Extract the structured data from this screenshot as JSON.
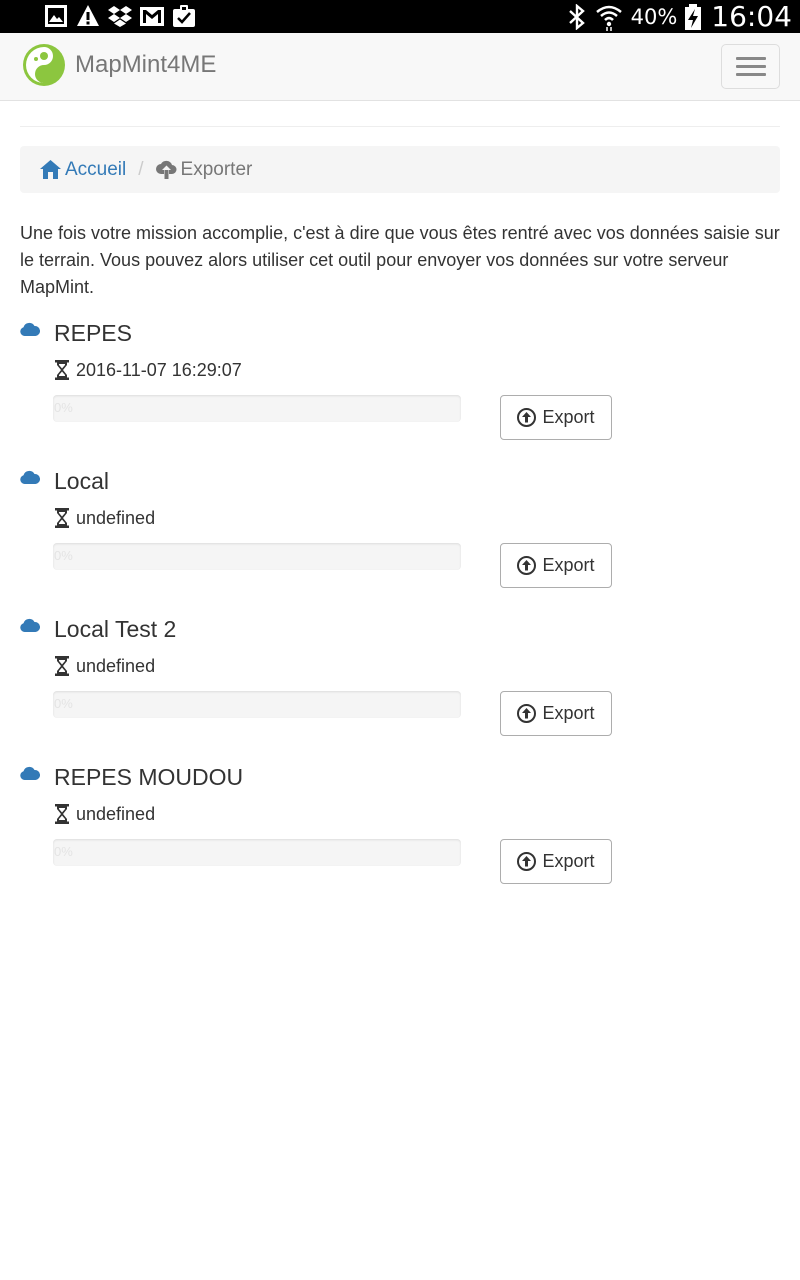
{
  "status_bar": {
    "notifications": [
      "image-icon",
      "warning-icon",
      "dropbox-icon",
      "gmail-icon",
      "clipboard-check-icon"
    ],
    "battery_percent": "40%",
    "time": "16:04"
  },
  "navbar": {
    "brand": "MapMint4ME"
  },
  "breadcrumb": {
    "home": "Accueil",
    "separator": "/",
    "current": "Exporter"
  },
  "intro": "Une fois votre mission accomplie, c'est à dire que vous êtes rentré avec vos données saisie sur le terrain. Vous pouvez alors utiliser cet outil pour envoyer vos données sur votre serveur MapMint.",
  "missions": [
    {
      "name": "REPES",
      "date": "2016-11-07 16:29:07",
      "progress": 0,
      "progress_label": "0%",
      "button": "Export"
    },
    {
      "name": "Local",
      "date": "undefined",
      "progress": 0,
      "progress_label": "0%",
      "button": "Export"
    },
    {
      "name": "Local Test 2",
      "date": "undefined",
      "progress": 0,
      "progress_label": "0%",
      "button": "Export"
    },
    {
      "name": "REPES MOUDOU",
      "date": "undefined",
      "progress": 0,
      "progress_label": "0%",
      "button": "Export"
    }
  ],
  "colors": {
    "link": "#337ab7",
    "cloud": "#337ab7",
    "logo_green": "#8cc63f"
  }
}
